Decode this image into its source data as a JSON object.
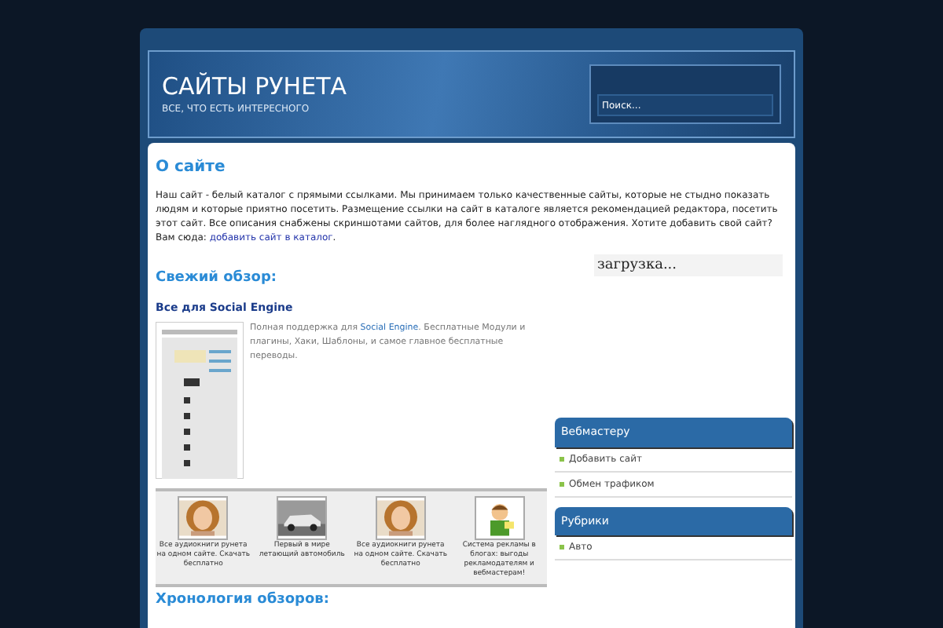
{
  "header": {
    "title": "САЙТЫ РУНЕТА",
    "tagline": "ВСЕ, ЧТО ЕСТЬ ИНТЕРЕСНОГО",
    "search": {
      "placeholder": "Поиск..."
    }
  },
  "about": {
    "heading": "О сайте",
    "text": "Наш сайт - белый каталог с прямыми ссылками. Мы принимаем только качественные сайты, которые не стыдно показать людям и которые приятно посетить. Размещение ссылки на сайт в каталоге является рекомендацией редактора, посетить этот сайт. Все описания снабжены скриншотами сайтов, для более наглядного отображения. Хотите добавить свой сайт? Вам сюда:",
    "link": "добавить сайт в каталог",
    "after": "."
  },
  "loading": "загрузка...",
  "review": {
    "heading": "Свежий обзор:",
    "title": "Все для Social Engine",
    "text_before": "Полная поддержка для ",
    "link": "Social Engine",
    "text_after": ". Бесплатные Модули и плагины, Хаки, Шаблоны, и самое главное бесплатные переводы."
  },
  "ads": [
    {
      "kind": "woman",
      "caption": "Все аудиокниги рунета на одном сайте. Скачать бесплатно"
    },
    {
      "kind": "car",
      "caption": "Первый в мире летающий автомобиль"
    },
    {
      "kind": "woman",
      "caption": "Все аудиокниги рунета на одном сайте. Скачать бесплатно"
    },
    {
      "kind": "cartoon",
      "caption": "Система рекламы в блогах: выгоды рекламодателям и вебмастерам!"
    }
  ],
  "next_heading": "Хронология обзоров:",
  "sidebar": [
    {
      "title": "Вебмастеру",
      "items": [
        "Добавить сайт",
        "Обмен трафиком"
      ]
    },
    {
      "title": "Рубрики",
      "items": [
        "Авто"
      ]
    }
  ]
}
